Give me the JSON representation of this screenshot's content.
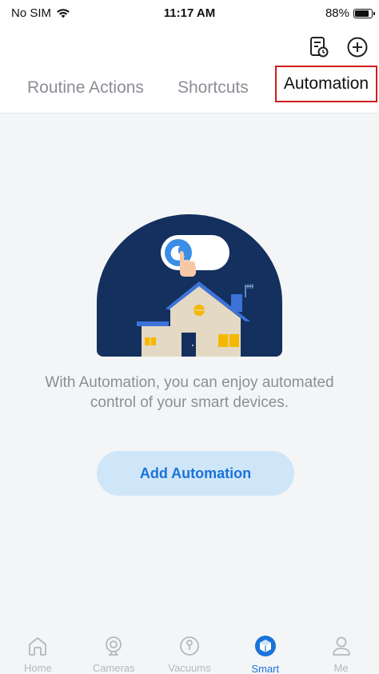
{
  "status_bar": {
    "carrier": "No SIM",
    "time": "11:17 AM",
    "battery": "88%"
  },
  "header": {
    "icons": [
      "log-list-icon",
      "add-circle-icon"
    ]
  },
  "tabs": [
    {
      "label": "Routine Actions",
      "active": false
    },
    {
      "label": "Shortcuts",
      "active": false
    },
    {
      "label": "Automation",
      "active": true
    }
  ],
  "empty_state": {
    "line1": "With Automation, you can enjoy automated",
    "line2": "control of your smart devices.",
    "button_label": "Add Automation"
  },
  "bottom_nav": [
    {
      "label": "Home",
      "icon": "home-icon",
      "active": false
    },
    {
      "label": "Cameras",
      "icon": "camera-icon",
      "active": false
    },
    {
      "label": "Vacuums",
      "icon": "vacuum-icon",
      "active": false
    },
    {
      "label": "Smart",
      "icon": "smart-cube-icon",
      "active": true
    },
    {
      "label": "Me",
      "icon": "person-icon",
      "active": false
    }
  ],
  "colors": {
    "accent": "#1a73d9",
    "tab_highlight_border": "#d11b1b",
    "illustration_bg": "#13305e"
  }
}
